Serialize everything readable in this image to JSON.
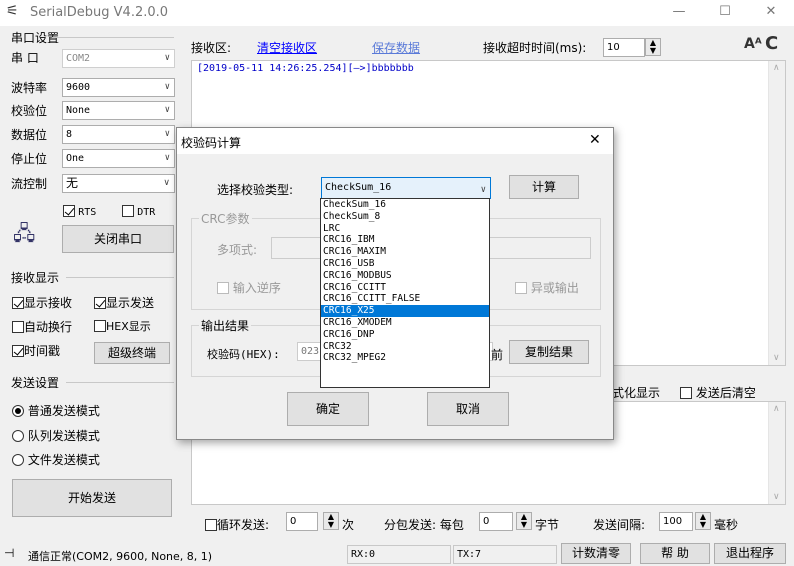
{
  "window": {
    "title": "SerialDebug V4.2.0.0",
    "btn_min": "—",
    "btn_max": "☐",
    "btn_close": "✕"
  },
  "serial": {
    "group_title": "串口设置",
    "port_label": "串  口",
    "port_value": "COM2",
    "baud_label": "波特率",
    "baud_value": "9600",
    "parity_label": "校验位",
    "parity_value": "None",
    "databits_label": "数据位",
    "databits_value": "8",
    "stopbits_label": "停止位",
    "stopbits_value": "One",
    "flow_label": "流控制",
    "flow_value": "无",
    "rts_label": "RTS",
    "dtr_label": "DTR",
    "close_port_button": "关闭串口"
  },
  "receive": {
    "group_title": "接收显示",
    "show_recv": "显示接收",
    "show_send": "显示发送",
    "auto_wrap": "自动换行",
    "hex_display": "HEX显示",
    "timestamp": "时间戳",
    "super_terminal": "超级终端",
    "area_label": "接收区:",
    "clear_link": "清空接收区",
    "save_link": "保存数据",
    "timeout_label": "接收超时时间(ms):",
    "timeout_value": "10",
    "log_line": "[2019-05-11 14:26:25.254][—>]bbbbbbb"
  },
  "send": {
    "group_title": "发送设置",
    "mode_normal": "普通发送模式",
    "mode_queue": "队列发送模式",
    "mode_file": "文件发送模式",
    "start_button": "开始发送",
    "format_display": "式化显示",
    "clear_after_send": "发送后清空",
    "loop_send": "循环发送:",
    "loop_value": "0",
    "loop_unit": "次",
    "packet_label": "分包发送: 每包",
    "packet_value": "0",
    "packet_unit": "字节",
    "interval_label": "发送间隔:",
    "interval_value": "100",
    "interval_unit": "毫秒"
  },
  "status": {
    "text": "通信正常(COM2, 9600, None, 8, 1)",
    "rx": "RX:0",
    "tx": "TX:7",
    "reset_count": "计数清零",
    "help": "帮  助",
    "exit": "退出程序"
  },
  "dialog": {
    "title": "校验码计算",
    "type_label": "选择校验类型:",
    "type_value": "CheckSum_16",
    "calc_button": "计算",
    "crc_group": "CRC参数",
    "poly_label": "多项式:",
    "input_reverse": "输入逆序",
    "xor_output": "异或输出",
    "result_group": "输出结果",
    "result_label": "校验码(HEX):",
    "result_value": "023",
    "front_label": "前",
    "copy_button": "复制结果",
    "ok_button": "确定",
    "cancel_button": "取消",
    "options": [
      "CheckSum_16",
      "CheckSum_8",
      "LRC",
      "CRC16_IBM",
      "CRC16_MAXIM",
      "CRC16_USB",
      "CRC16_MODBUS",
      "CRC16_CCITT",
      "CRC16_CCITT_FALSE",
      "CRC16_X25",
      "CRC16_XMODEM",
      "CRC16_DNP",
      "CRC32",
      "CRC32_MPEG2"
    ],
    "highlighted_option": "CRC16_X25"
  },
  "colors": {
    "accent": "#0078d7",
    "link": "#0000ff"
  },
  "icons": {
    "app": "usb-icon",
    "font": "font-size-icon",
    "refresh": "refresh-icon",
    "ports": "computer-ports-icon",
    "pin": "pin-icon"
  }
}
